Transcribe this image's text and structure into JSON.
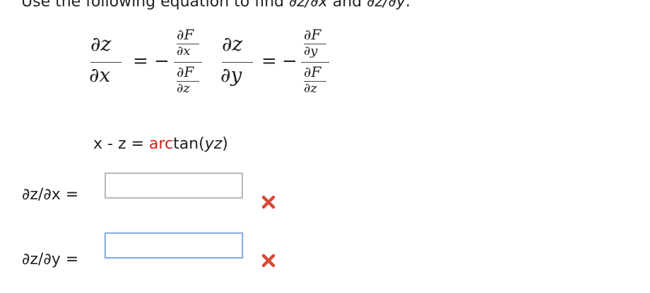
{
  "instruction": {
    "text": "Use the following equation to find ",
    "sym1": "∂z/∂x",
    "mid": " and ",
    "sym2": "∂z/∂y",
    "end": "."
  },
  "formula": {
    "partial_z": "∂z",
    "partial_x": "∂x",
    "partial_y": "∂y",
    "partial_F": "∂F",
    "partial_x_small": "∂x",
    "partial_y_small": "∂y",
    "partial_z_small": "∂z",
    "equals": "=",
    "minus": "−"
  },
  "equation": {
    "lhs": "x - z = ",
    "fn": "arc",
    "tail_start": "tan(",
    "arg": "yz",
    "tail_end": ")"
  },
  "answers": [
    {
      "label": "∂z/∂x =",
      "value": "",
      "status": "incorrect"
    },
    {
      "label": "∂z/∂y =",
      "value": "",
      "status": "incorrect"
    }
  ],
  "colors": {
    "function_highlight": "#d0211b",
    "incorrect_mark": "#d64a3a",
    "focus_border": "#8ab0e0"
  },
  "icons": {
    "incorrect": "x-mark-icon"
  }
}
